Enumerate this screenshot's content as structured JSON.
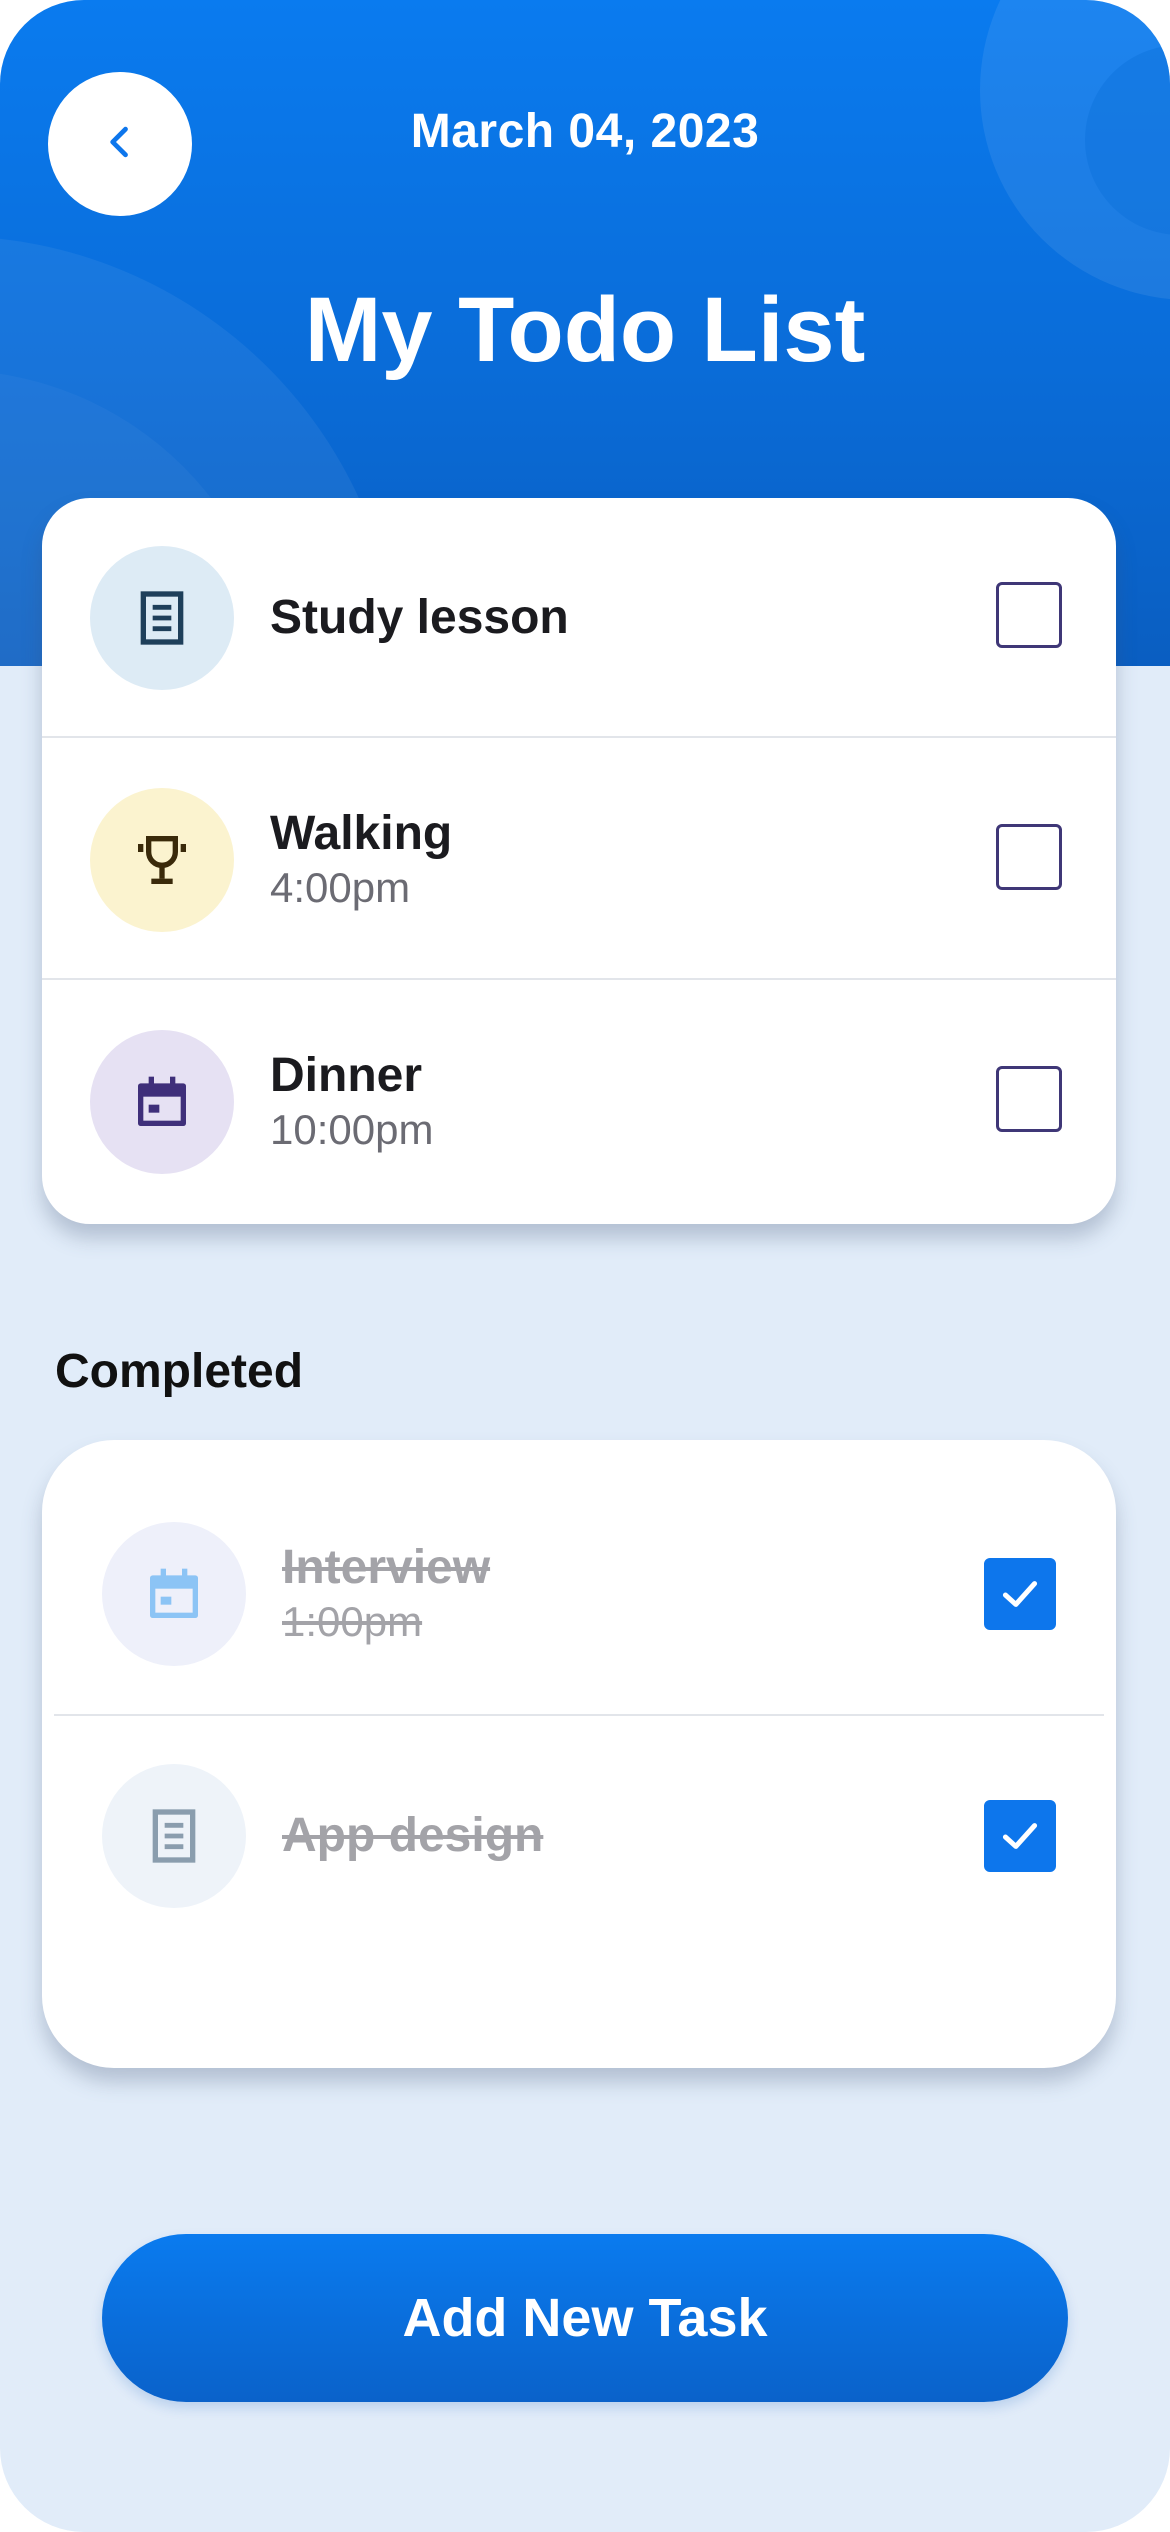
{
  "header": {
    "date": "March 04, 2023",
    "title": "My Todo List",
    "back_icon": "chevron-left-icon"
  },
  "todo": {
    "items": [
      {
        "title": "Study lesson",
        "time": "",
        "icon": "notes-icon",
        "icon_bg": "#DDEBF5",
        "icon_color": "#1E3F5A",
        "checked": false
      },
      {
        "title": "Walking",
        "time": "4:00pm",
        "icon": "trophy-icon",
        "icon_bg": "#FBF3CF",
        "icon_color": "#3A2A0A",
        "checked": false
      },
      {
        "title": "Dinner",
        "time": "10:00pm",
        "icon": "calendar-icon",
        "icon_bg": "#E6E1F3",
        "icon_color": "#3F2F7A",
        "checked": false
      }
    ]
  },
  "completed": {
    "label": "Completed",
    "items": [
      {
        "title": "Interview",
        "time": "1:00pm",
        "icon": "calendar-icon",
        "icon_bg": "#EEF0FA",
        "icon_color": "#8CC4F5",
        "checked": true
      },
      {
        "title": "App design",
        "time": "",
        "icon": "notes-icon",
        "icon_bg": "#EEF3F9",
        "icon_color": "#8A9DAE",
        "checked": true
      }
    ]
  },
  "actions": {
    "add_label": "Add New Task"
  },
  "colors": {
    "primary": "#0D76EC",
    "background": "#E1ECF9",
    "checkbox_border": "#3F3777"
  }
}
